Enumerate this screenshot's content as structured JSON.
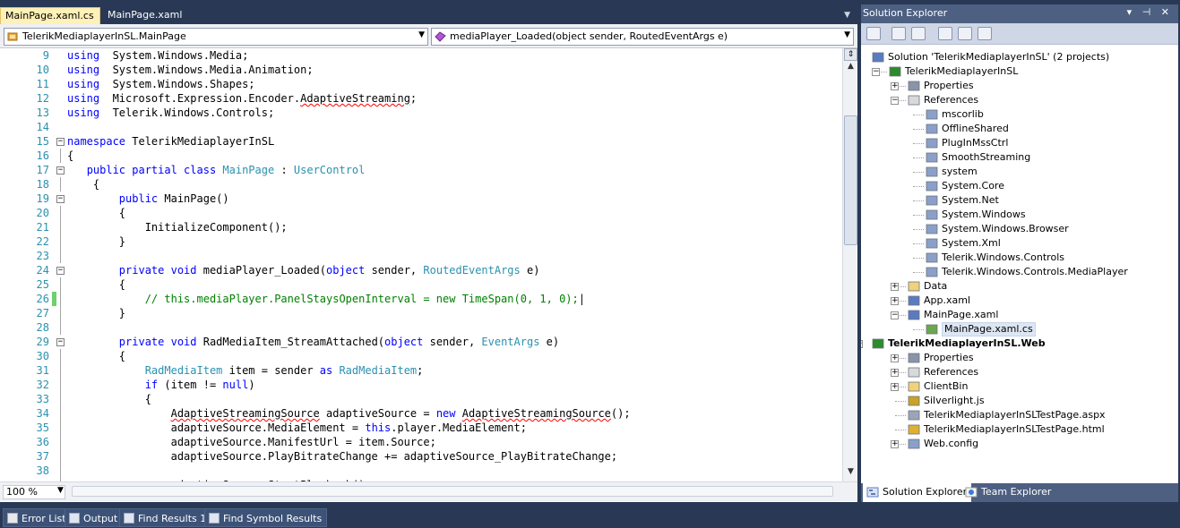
{
  "editor": {
    "tabs": [
      {
        "label": "MainPage.xaml.cs",
        "active": true
      },
      {
        "label": "MainPage.xaml",
        "active": false
      }
    ],
    "class_combo": "TelerikMediaplayerInSL.MainPage",
    "member_combo": "mediaPlayer_Loaded(object sender, RoutedEventArgs e)",
    "zoom": "100 %",
    "lines": [
      {
        "n": "9",
        "t": [
          [
            "kw",
            "using"
          ],
          [
            "",
            "  System.Windows.Media;"
          ]
        ]
      },
      {
        "n": "10",
        "t": [
          [
            "kw",
            "using"
          ],
          [
            "",
            "  System.Windows.Media.Animation;"
          ]
        ]
      },
      {
        "n": "11",
        "t": [
          [
            "kw",
            "using"
          ],
          [
            "",
            "  System.Windows.Shapes;"
          ]
        ]
      },
      {
        "n": "12",
        "t": [
          [
            "kw",
            "using"
          ],
          [
            "",
            "  Microsoft.Expression.Encoder."
          ],
          [
            "sq",
            "AdaptiveStreaming"
          ],
          [
            "",
            ";"
          ]
        ]
      },
      {
        "n": "13",
        "t": [
          [
            "kw",
            "using"
          ],
          [
            "",
            "  Telerik.Windows.Controls;"
          ]
        ]
      },
      {
        "n": "14",
        "t": []
      },
      {
        "n": "15",
        "t": [
          [
            "kw",
            "namespace"
          ],
          [
            "",
            " TelerikMediaplayerInSL"
          ]
        ],
        "box": "-"
      },
      {
        "n": "16",
        "t": [
          [
            "",
            "{"
          ]
        ]
      },
      {
        "n": "17",
        "t": [
          [
            "",
            "   "
          ],
          [
            "kw",
            "public partial class"
          ],
          [
            "",
            ""
          ],
          [
            "ty",
            " MainPage"
          ],
          [
            "",
            " : "
          ],
          [
            "ty",
            "UserControl"
          ]
        ],
        "box": "-"
      },
      {
        "n": "18",
        "t": [
          [
            "",
            "    {"
          ]
        ]
      },
      {
        "n": "19",
        "t": [
          [
            "",
            "        "
          ],
          [
            "kw",
            "public"
          ],
          [
            "",
            " MainPage()"
          ]
        ],
        "box": "-"
      },
      {
        "n": "20",
        "t": [
          [
            "",
            "        {"
          ]
        ]
      },
      {
        "n": "21",
        "t": [
          [
            "",
            "            InitializeComponent();"
          ]
        ]
      },
      {
        "n": "22",
        "t": [
          [
            "",
            "        }"
          ]
        ]
      },
      {
        "n": "23",
        "t": []
      },
      {
        "n": "24",
        "t": [
          [
            "",
            "        "
          ],
          [
            "kw",
            "private void"
          ],
          [
            "",
            " mediaPlayer_Loaded("
          ],
          [
            "kw",
            "object"
          ],
          [
            "",
            " sender, "
          ],
          [
            "ty",
            "RoutedEventArgs"
          ],
          [
            "",
            " e)"
          ]
        ],
        "box": "-"
      },
      {
        "n": "25",
        "t": [
          [
            "",
            "        {"
          ]
        ]
      },
      {
        "n": "26",
        "t": [
          [
            "",
            "            "
          ],
          [
            "cm",
            "// this.mediaPlayer.PanelStaysOpenInterval = new TimeSpan(0, 1, 0);"
          ],
          [
            "",
            "|"
          ]
        ],
        "changed": true
      },
      {
        "n": "27",
        "t": [
          [
            "",
            "        }"
          ]
        ]
      },
      {
        "n": "28",
        "t": []
      },
      {
        "n": "29",
        "t": [
          [
            "",
            "        "
          ],
          [
            "kw",
            "private void"
          ],
          [
            "",
            " RadMediaItem_StreamAttached("
          ],
          [
            "kw",
            "object"
          ],
          [
            "",
            " sender, "
          ],
          [
            "ty",
            "EventArgs"
          ],
          [
            "",
            " e)"
          ]
        ],
        "box": "-"
      },
      {
        "n": "30",
        "t": [
          [
            "",
            "        {"
          ]
        ]
      },
      {
        "n": "31",
        "t": [
          [
            "",
            "            "
          ],
          [
            "ty",
            "RadMediaItem"
          ],
          [
            "",
            " item = sender "
          ],
          [
            "kw",
            "as"
          ],
          [
            "ty",
            " RadMediaItem"
          ],
          [
            "",
            ";"
          ]
        ]
      },
      {
        "n": "32",
        "t": [
          [
            "",
            "            "
          ],
          [
            "kw",
            "if"
          ],
          [
            "",
            " (item != "
          ],
          [
            "kw",
            "null"
          ],
          [
            "",
            ")"
          ]
        ]
      },
      {
        "n": "33",
        "t": [
          [
            "",
            "            {"
          ]
        ]
      },
      {
        "n": "34",
        "t": [
          [
            "",
            "                "
          ],
          [
            "sq",
            "AdaptiveStreamingSource"
          ],
          [
            "",
            " adaptiveSource = "
          ],
          [
            "kw",
            "new"
          ],
          [
            "",
            " "
          ],
          [
            "sq",
            "AdaptiveStreamingSource"
          ],
          [
            "",
            "();"
          ]
        ]
      },
      {
        "n": "35",
        "t": [
          [
            "",
            "                adaptiveSource.MediaElement = "
          ],
          [
            "kw",
            "this"
          ],
          [
            "",
            ".player.MediaElement;"
          ]
        ]
      },
      {
        "n": "36",
        "t": [
          [
            "",
            "                adaptiveSource.ManifestUrl = item.Source;"
          ]
        ]
      },
      {
        "n": "37",
        "t": [
          [
            "",
            "                adaptiveSource.PlayBitrateChange += adaptiveSource_PlayBitrateChange;"
          ]
        ]
      },
      {
        "n": "38",
        "t": []
      },
      {
        "n": "",
        "t": [
          [
            "",
            "                adaptiveSource.StartPlayback();"
          ]
        ]
      }
    ]
  },
  "solution_explorer": {
    "title": "Solution Explorer",
    "title_buttons": "▾ ⊣ ✕",
    "items": [
      {
        "label": "Solution 'TelerikMediaplayerInSL' (2 projects)",
        "level": 0,
        "icon": "solution-icon",
        "color": "#5b7bc0"
      },
      {
        "label": "TelerikMediaplayerInSL",
        "level": 1,
        "icon": "csharp-project-icon",
        "exp": "-",
        "color": "#2d8a2d"
      },
      {
        "label": "Properties",
        "level": 2,
        "icon": "properties-icon",
        "exp": "+",
        "color": "#8a94a8"
      },
      {
        "label": "References",
        "level": 2,
        "icon": "references-folder-icon",
        "exp": "-",
        "color": "#d9d9d9"
      },
      {
        "label": "mscorlib",
        "level": 3,
        "icon": "reference-icon",
        "color": "#8aa0c8"
      },
      {
        "label": "OfflineShared",
        "level": 3,
        "icon": "reference-icon",
        "color": "#8aa0c8"
      },
      {
        "label": "PlugInMssCtrl",
        "level": 3,
        "icon": "reference-icon",
        "color": "#8aa0c8"
      },
      {
        "label": "SmoothStreaming",
        "level": 3,
        "icon": "reference-icon",
        "color": "#8aa0c8"
      },
      {
        "label": "system",
        "level": 3,
        "icon": "reference-icon",
        "color": "#8aa0c8"
      },
      {
        "label": "System.Core",
        "level": 3,
        "icon": "reference-icon",
        "color": "#8aa0c8"
      },
      {
        "label": "System.Net",
        "level": 3,
        "icon": "reference-icon",
        "color": "#8aa0c8"
      },
      {
        "label": "System.Windows",
        "level": 3,
        "icon": "reference-icon",
        "color": "#8aa0c8"
      },
      {
        "label": "System.Windows.Browser",
        "level": 3,
        "icon": "reference-icon",
        "color": "#8aa0c8"
      },
      {
        "label": "System.Xml",
        "level": 3,
        "icon": "reference-icon",
        "color": "#8aa0c8"
      },
      {
        "label": "Telerik.Windows.Controls",
        "level": 3,
        "icon": "reference-icon",
        "color": "#8aa0c8"
      },
      {
        "label": "Telerik.Windows.Controls.MediaPlayer",
        "level": 3,
        "icon": "reference-icon",
        "color": "#8aa0c8"
      },
      {
        "label": "Data",
        "level": 2,
        "icon": "folder-icon",
        "exp": "+",
        "color": "#f0d27a"
      },
      {
        "label": "App.xaml",
        "level": 2,
        "icon": "xaml-file-icon",
        "exp": "+",
        "color": "#5b7bc0"
      },
      {
        "label": "MainPage.xaml",
        "level": 2,
        "icon": "xaml-file-icon",
        "exp": "-",
        "color": "#5b7bc0"
      },
      {
        "label": "MainPage.xaml.cs",
        "level": 3,
        "icon": "cs-file-icon",
        "color": "#6aa84f",
        "selected": true
      },
      {
        "label": "TelerikMediaplayerInSL.Web",
        "level": 0,
        "icon": "web-project-icon",
        "exp": "-",
        "bold": true,
        "color": "#2d8a2d"
      },
      {
        "label": "Properties",
        "level": 2,
        "icon": "properties-icon",
        "exp": "+",
        "color": "#8a94a8"
      },
      {
        "label": "References",
        "level": 2,
        "icon": "references-folder-icon",
        "exp": "+",
        "color": "#d9d9d9"
      },
      {
        "label": "ClientBin",
        "level": 2,
        "icon": "folder-icon",
        "exp": "+",
        "color": "#f0d27a"
      },
      {
        "label": "Silverlight.js",
        "level": 2,
        "icon": "js-file-icon",
        "color": "#c9a227"
      },
      {
        "label": "TelerikMediaplayerInSLTestPage.aspx",
        "level": 2,
        "icon": "aspx-file-icon",
        "color": "#9aa5b8"
      },
      {
        "label": "TelerikMediaplayerInSLTestPage.html",
        "level": 2,
        "icon": "html-file-icon",
        "color": "#e0b030"
      },
      {
        "label": "Web.config",
        "level": 2,
        "icon": "config-file-icon",
        "exp": "+",
        "color": "#8aa0c8"
      }
    ],
    "tabs": [
      {
        "label": "Solution Explorer",
        "active": true
      },
      {
        "label": "Team Explorer",
        "active": false
      }
    ]
  },
  "bottom_tabs": [
    {
      "label": "Error List",
      "icon": "error-list-icon"
    },
    {
      "label": "Output",
      "icon": "output-icon"
    },
    {
      "label": "Find Results 1",
      "icon": "find-results-icon"
    },
    {
      "label": "Find Symbol Results",
      "icon": "find-symbol-icon"
    }
  ]
}
